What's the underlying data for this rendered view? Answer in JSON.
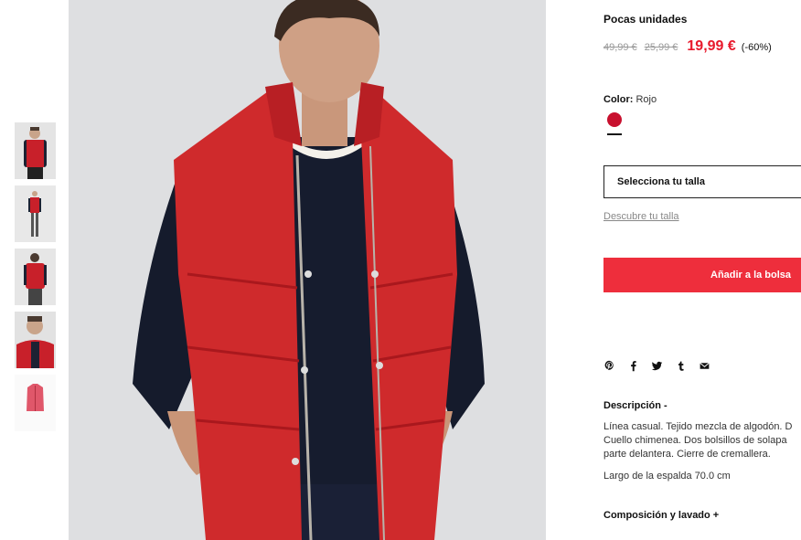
{
  "thumbnails": [
    {
      "label": "front-view"
    },
    {
      "label": "full-body-view"
    },
    {
      "label": "back-view"
    },
    {
      "label": "close-up-view"
    },
    {
      "label": "product-only-view"
    }
  ],
  "product": {
    "stock_note": "Pocas unidades",
    "original_price": "49,99 €",
    "previous_price": "25,99 €",
    "sale_price": "19,99 €",
    "discount": "(-60%)",
    "color_label": "Color:",
    "color_value": "Rojo",
    "swatch_color": "#c8102e",
    "size_select_placeholder": "Selecciona tu talla",
    "size_guide_link": "Descubre tu talla",
    "add_to_bag_label": "Añadir a la bolsa",
    "accent_color": "#ee2e3c"
  },
  "share": {
    "icons": [
      "pinterest-icon",
      "facebook-icon",
      "twitter-icon",
      "tumblr-icon",
      "email-icon"
    ]
  },
  "description": {
    "title": "Descripción -",
    "lines": [
      "Línea casual. Tejido mezcla de algodón. D",
      "Cuello chimenea. Dos bolsillos de solapa",
      "parte delantera. Cierre de cremallera."
    ],
    "back_length": "Largo de la espalda 70.0 cm"
  },
  "composition": {
    "title": "Composición y lavado +"
  }
}
